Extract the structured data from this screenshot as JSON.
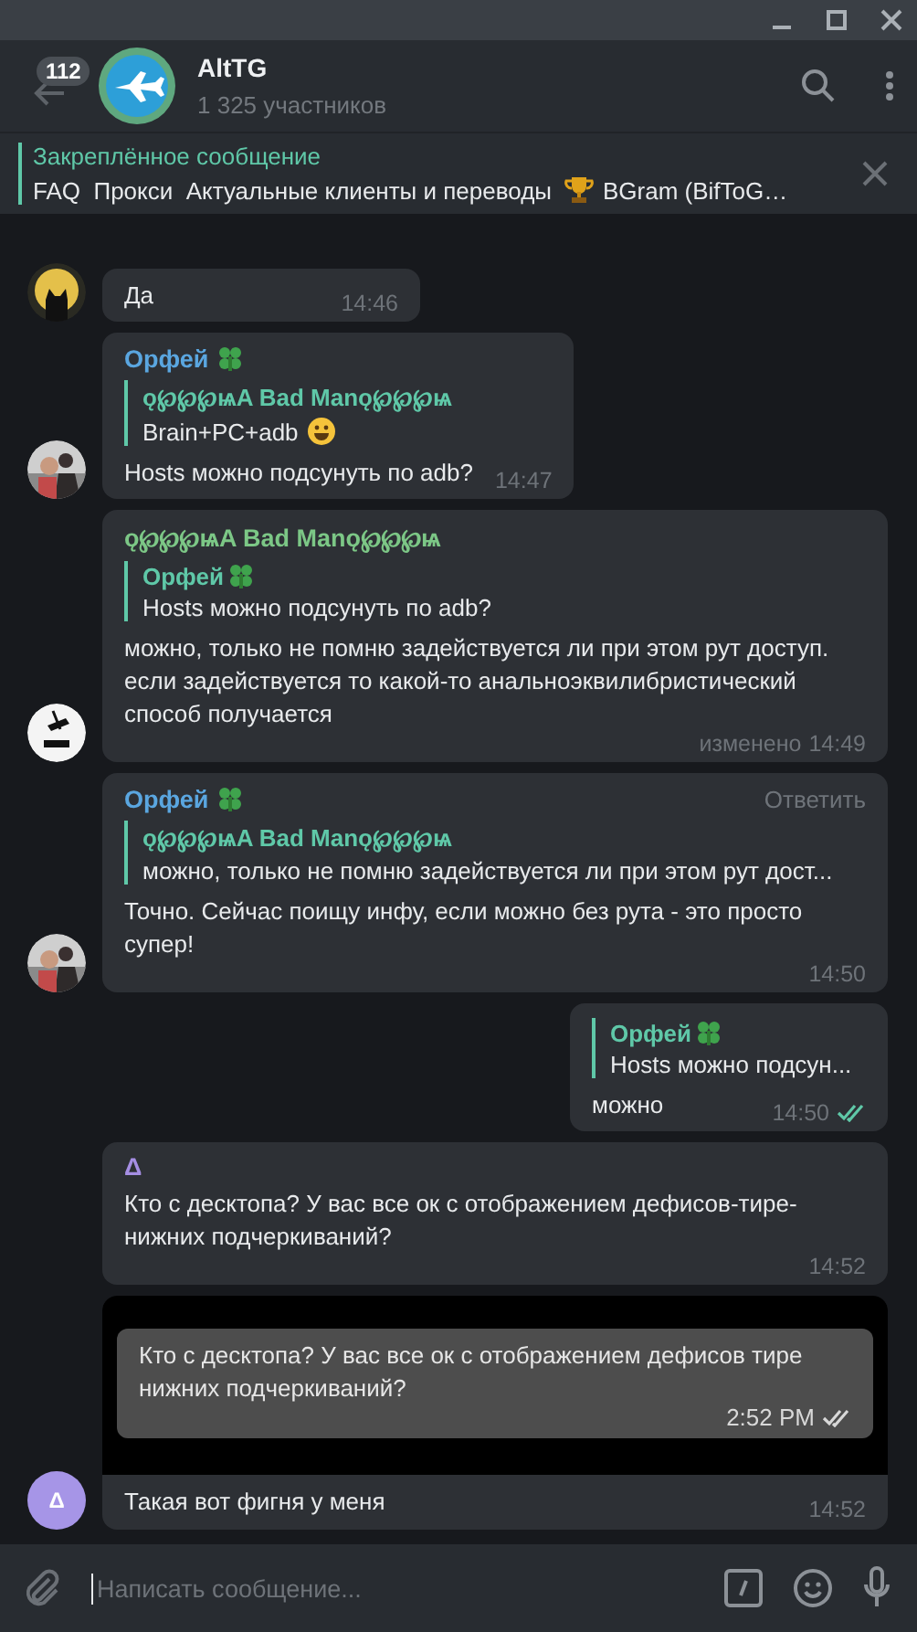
{
  "header": {
    "unread_badge": "112",
    "title": "AltTG",
    "subtitle": "1 325 участников"
  },
  "pinned": {
    "label": "Закреплённое сообщение",
    "text": "FAQ  Прокси  Актуальные клиенты и переводы",
    "trophy": true,
    "text_2": "BGram (BifToG…"
  },
  "messages": [
    {
      "kind": "incoming",
      "text": "Да",
      "time": "14:46"
    },
    {
      "kind": "incoming",
      "sender": {
        "name": "Орфей",
        "color": "#5aa6e0",
        "clover": true
      },
      "reply": {
        "author": "ǫ℘℘℘ѩA Bad Manǫ℘℘℘ѩ",
        "clover": false,
        "text": "Brain+PC+adb",
        "smiley": true
      },
      "text": "Hosts можно подсунуть по adb?",
      "time": "14:47"
    },
    {
      "kind": "incoming",
      "sender": {
        "name": "ǫ℘℘℘ѩA Bad Manǫ℘℘℘ѩ",
        "color": "#7cc786",
        "clover": false
      },
      "reply": {
        "author": "Орфей",
        "clover": true,
        "text": "Hosts можно подсунуть по adb?",
        "smiley": false
      },
      "text": "можно, только не помню задействуется ли при этом рут доступ. если задействуется то какой-то анальноэквилибристический способ получается",
      "edited": "изменено",
      "time": "14:49"
    },
    {
      "kind": "incoming",
      "sender": {
        "name": "Орфей",
        "color": "#5aa6e0",
        "clover": true
      },
      "action": "Ответить",
      "reply": {
        "author": "ǫ℘℘℘ѩA Bad Manǫ℘℘℘ѩ",
        "clover": false,
        "text": "можно, только не помню задействуется ли при этом рут дост...",
        "smiley": false
      },
      "text": "Точно. Сейчас поищу инфу, если можно без рута - это просто супер!",
      "time": "14:50"
    },
    {
      "kind": "outgoing",
      "reply": {
        "author": "Орфей",
        "clover": true,
        "text": "Hosts можно подсун...",
        "smiley": false
      },
      "text": "можно",
      "time": "14:50",
      "read": true
    },
    {
      "kind": "incoming",
      "sender": {
        "name": "Δ",
        "color": "#a58ee3",
        "clover": false
      },
      "text": "Кто с десктопа? У вас все ок с отображением дефисов-тире-нижних подчеркиваний?",
      "time": "14:52"
    },
    {
      "avatar": {
        "kind": "letter",
        "text": "Δ"
      },
      "shot": {
        "text": "Кто с десктопа? У вас все ок с отображением дефисов тире нижних подчеркиваний?",
        "time": "2:52 PM",
        "read": true
      },
      "text": "Такая вот фигня у меня",
      "time": "14:52"
    }
  ],
  "composer": {
    "placeholder": "Написать сообщение..."
  }
}
